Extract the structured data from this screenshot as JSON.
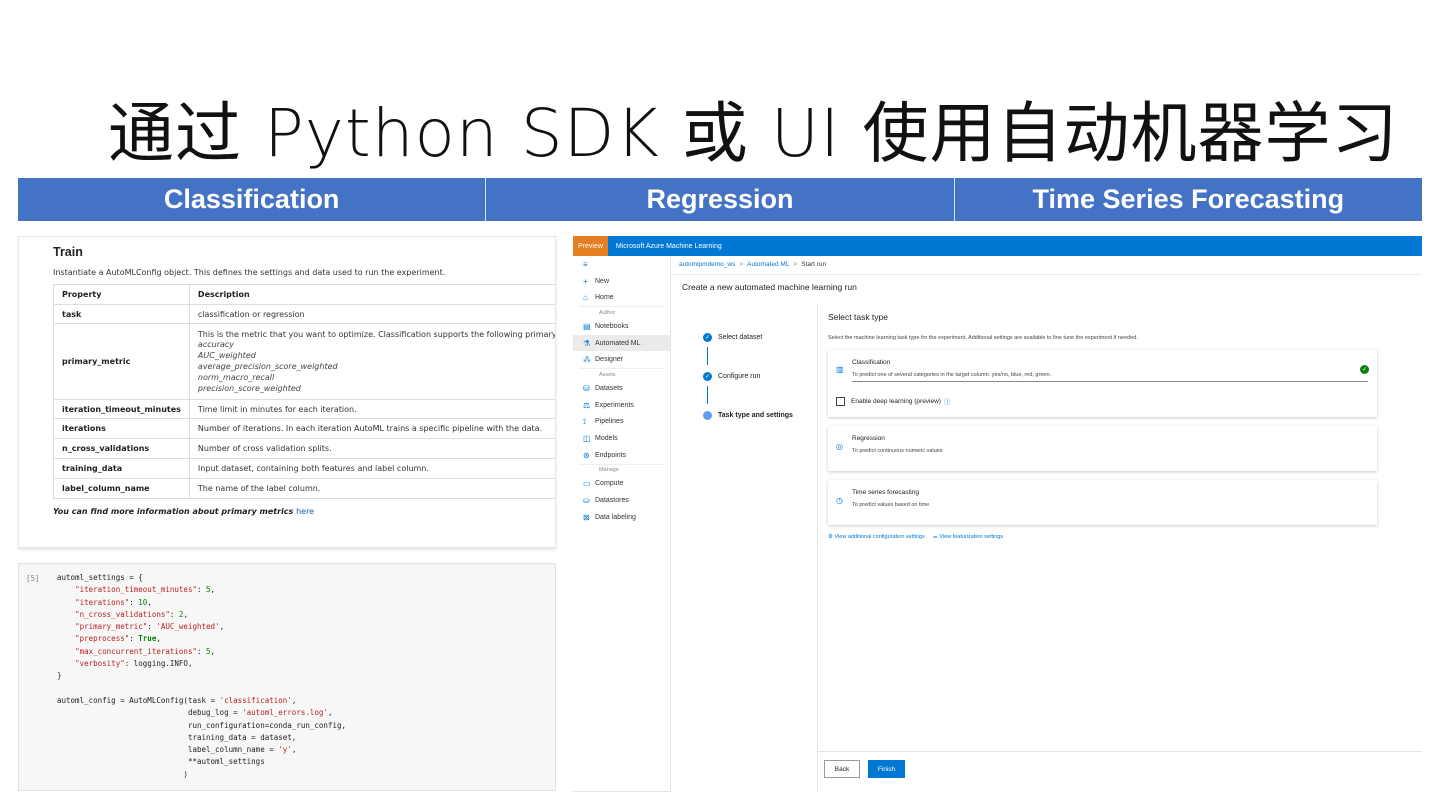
{
  "slide": {
    "title": "通过 Python SDK 或 UI 使用自动机器学习",
    "headers": [
      "Classification",
      "Regression",
      "Time Series Forecasting"
    ]
  },
  "doc": {
    "heading": "Train",
    "intro": "Instantiate a AutoMLConfig object. This defines the settings and data used to run the experiment.",
    "columns": [
      "Property",
      "Description"
    ],
    "rows": [
      {
        "key": "task",
        "value": "classification or regression"
      },
      {
        "key": "primary_metric",
        "value": "This is the metric that you want to optimize. Classification supports the following primary metrics:",
        "metrics": [
          "accuracy",
          "AUC_weighted",
          "average_precision_score_weighted",
          "norm_macro_recall",
          "precision_score_weighted"
        ]
      },
      {
        "key": "iteration_timeout_minutes",
        "value": "Time limit in minutes for each iteration."
      },
      {
        "key": "iterations",
        "value": "Number of iterations. In each iteration AutoML trains a specific pipeline with the data."
      },
      {
        "key": "n_cross_validations",
        "value": "Number of cross validation splits."
      },
      {
        "key": "training_data",
        "value": "Input dataset, containing both features and label column."
      },
      {
        "key": "label_column_name",
        "value": "The name of the label column."
      }
    ],
    "more_text": "You can find more information about primary metrics ",
    "more_link": "here"
  },
  "code": {
    "prompt": "[5]"
  },
  "azure": {
    "preview": "Preview",
    "product": "Microsoft Azure Machine Learning",
    "nav": {
      "menu_icon": "≡",
      "items_top": [
        {
          "icon": "+",
          "label": "New"
        },
        {
          "icon": "⌂",
          "label": "Home"
        }
      ],
      "section_author": "Author",
      "items_author": [
        {
          "icon": "▤",
          "label": "Notebooks"
        },
        {
          "icon": "⚗",
          "label": "Automated ML"
        },
        {
          "icon": "⁂",
          "label": "Designer"
        }
      ],
      "section_assets": "Assets",
      "items_assets": [
        {
          "icon": "⛁",
          "label": "Datasets"
        },
        {
          "icon": "⚖",
          "label": "Experiments"
        },
        {
          "icon": "⟟",
          "label": "Pipelines"
        },
        {
          "icon": "◫",
          "label": "Models"
        },
        {
          "icon": "⊛",
          "label": "Endpoints"
        }
      ],
      "section_manage": "Manage",
      "items_manage": [
        {
          "icon": "▭",
          "label": "Compute"
        },
        {
          "icon": "⛀",
          "label": "Datastores"
        },
        {
          "icon": "⊠",
          "label": "Data labeling"
        }
      ]
    },
    "breadcrumb": [
      "automlpmdemo_ws",
      "Automated ML",
      "Start run"
    ],
    "page_title": "Create a new automated machine learning run",
    "steps": [
      "Select dataset",
      "Configure run",
      "Task type and settings"
    ],
    "select_title": "Select task type",
    "select_desc": "Select the machine learning task type for the experiment. Additional settings are available to fine tune the experiment if needed.",
    "tasks": [
      {
        "name": "Classification",
        "desc": "To predict one of several categories in the target column. yes/no, blue, red, green."
      },
      {
        "name": "Regression",
        "desc": "To predict continuous numeric values"
      },
      {
        "name": "Time series forecasting",
        "desc": "To predict values based on time"
      }
    ],
    "deep_learning": "Enable deep learning (preview)",
    "links": [
      "View additional configuration settings",
      "View featurization settings"
    ],
    "btn_back": "Back",
    "btn_finish": "Finish"
  }
}
